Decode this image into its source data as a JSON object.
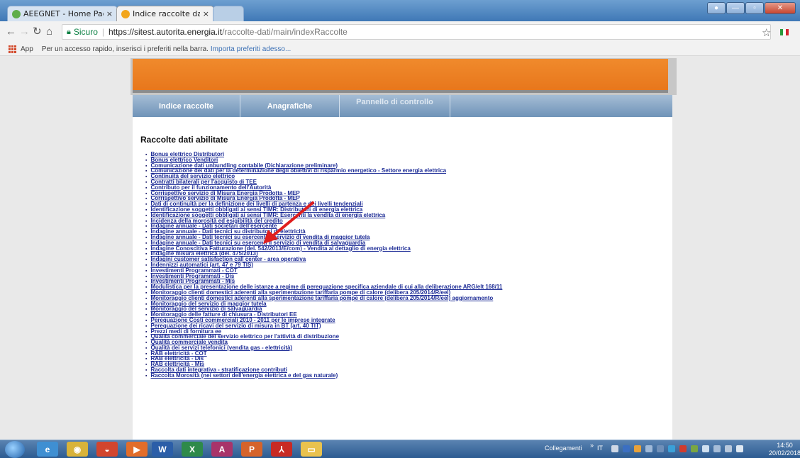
{
  "browser": {
    "tabs": [
      {
        "title": "AEEGNET - Home Page",
        "active": false
      },
      {
        "title": "Indice raccolte dati",
        "active": true
      }
    ],
    "address": {
      "secure_label": "Sicuro",
      "url_host": "https://sitest.autorita.energia.it",
      "url_path": "/raccolte-dati/main/indexRaccolte"
    },
    "bookmarks": {
      "apps_label": "App",
      "hint": "Per un accesso rapido, inserisci i preferiti nella barra.",
      "import_link": "Importa preferiti adesso..."
    }
  },
  "page": {
    "nav_tabs": [
      "Indice raccolte",
      "Anagrafiche",
      "Pannello di controllo"
    ],
    "heading": "Raccolte dati abilitate",
    "items": [
      "Bonus elettrico Distributori",
      "Bonus elettrico Venditori",
      "Comunicazione dati unbundling contabile (Dichiarazione preliminare)",
      "Comunicazione dei dati per la determinazione degli obiettivi di risparmio energetico - Settore energia elettrica",
      "Continuità del servizio elettrico",
      "Contratti bilaterali per l'acquisto di TEE",
      "Contributo per il funzionamento dell'Autorità",
      "Corrispettivo servizio di Misura Energia Prodotta - MEP",
      "Corrispettivo servizio di Misura Energia Prodotta - MEP",
      "Dati di continuità per la definizione dei livelli di partenza e dei livelli tendenziali",
      "Identificazione soggetti obbligati ai sensi TIMR: Distributori di energia elettrica",
      "Identificazione soggetti obbligati ai sensi TIMR: Esercenti la vendita di energia elettrica",
      "Incidenza della morosità ed esigibilità del credito",
      "Indagine annuale - Dati societari dell'esercente",
      "Indagine annuale - Dati tecnici su distributori di elettricità",
      "Indagine annuale - Dati tecnici su esercenti il servizio di vendita di maggior tutela",
      "Indagine annuale - Dati tecnici su esercenti il servizio di vendita di salvaguardia",
      "Indagine Conoscitiva Fatturazione (del. 542/2013/E/com) - Vendita al dettaglio di energia elettrica",
      "Indagine misura elettrica (del. 475/2013)",
      "Indagini customer satisfaction call center - area operativa",
      "Indennizzi automatici (art. 47 e 79 TIS)",
      "Investimenti Programmati - COT",
      "Investimenti Programmati - Dis",
      "Investimenti Programmati - Mis",
      "Modulistica per la presentazione delle istanze a regime di perequazione specifica aziendale di cui alla deliberazione ARG/elt 168/11",
      "Monitoraggio clienti domestici aderenti alla sperimentazione tariffaria pompe di calore (delibera 205/2014/R/eel)",
      "Monitoraggio clienti domestici aderenti alla sperimentazione tariffaria pompe di calore (delibera 205/2014/R/eel) aggiornamento",
      "Monitoraggio del servizio di maggior tutela",
      "Monitoraggio del servizio di salvaguardia",
      "Monitoraggio delle fatture di chiusura - Distributori EE",
      "Perequazione Costi commerciali 2010 - 2011 per le imprese integrate",
      "Perequazione dei ricavi del servizio di misura in BT (art. 40 TIT)",
      "Prezzi medi di fornitura ee",
      "Qualità commerciale del servizio elettrico per l'attività di distribuzione",
      "Qualità commerciale vendita",
      "Qualità dei servizi telefonici (vendita gas - elettricità)",
      "RAB elettricità - COT",
      "RAB elettricità - Dis",
      "RAB elettricità - Mis",
      "Raccolta dati integrativa - stratificazione contributi",
      "Raccolta Morosità (nei settori dell'energia elettrica e del gas naturale)"
    ]
  },
  "taskbar": {
    "tray_label": "Collegamenti",
    "lang": "IT",
    "time": "14:50",
    "date": "20/02/2018"
  },
  "colors": {
    "orange_banner": "#ee7f24",
    "nav_blue": "#7f9fc1",
    "link_blue": "#1d2c96",
    "arrow_red": "#e01e1e"
  }
}
